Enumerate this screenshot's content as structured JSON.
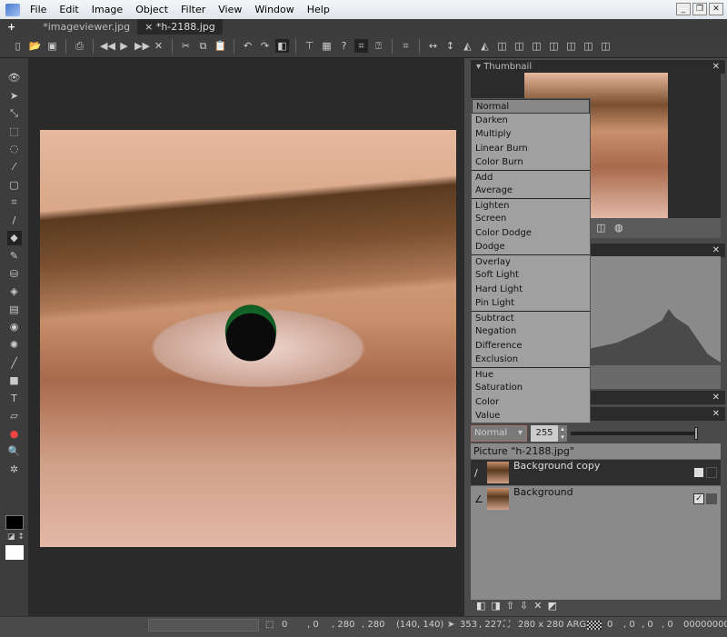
{
  "menu": {
    "items": [
      "File",
      "Edit",
      "Image",
      "Object",
      "Filter",
      "View",
      "Window",
      "Help"
    ]
  },
  "tabs": [
    {
      "label": "*imageviewer.jpg",
      "active": false
    },
    {
      "label": "*h-2188.jpg",
      "active": true,
      "close": "×"
    }
  ],
  "toolbar_icons": [
    "new-icon",
    "open-icon",
    "save-icon",
    "print-icon",
    "first-icon",
    "play-icon",
    "last-icon",
    "close-icon",
    "cut-icon",
    "copy-icon",
    "paste-icon",
    "undo-icon",
    "redo-icon",
    "split-view-icon",
    "crop-icon",
    "grid-icon",
    "help-icon",
    "crop-active-icon",
    "zoom-help-icon",
    "resize-icon",
    "flip-h-icon",
    "flip-v-icon",
    "rotate-icon"
  ],
  "panels": {
    "thumbnail": {
      "title": "Thumbnail"
    }
  },
  "blend_modes": {
    "selected": "Normal",
    "groups": [
      [
        "Normal",
        "Darken",
        "Multiply",
        "Linear Burn",
        "Color Burn"
      ],
      [
        "Add",
        "Average"
      ],
      [
        "Lighten",
        "Screen",
        "Color Dodge",
        "Dodge"
      ],
      [
        "Overlay",
        "Soft Light",
        "Hard Light",
        "Pin Light"
      ],
      [
        "Subtract",
        "Negation",
        "Difference",
        "Exclusion"
      ],
      [
        "Hue",
        "Saturation",
        "Color",
        "Value"
      ]
    ]
  },
  "layers": {
    "blend": "Normal",
    "opacity": "255",
    "picture": "Picture \"h-2188.jpg\"",
    "items": [
      {
        "name": "Background copy",
        "visible": true,
        "selected": true
      },
      {
        "name": "Background",
        "visible": true,
        "locked": true
      }
    ]
  },
  "status": {
    "sel_x": "0",
    "sel_y": ", 0",
    "sel_w": ", 280",
    "sel_h": ", 280",
    "center": "(140, 140)",
    "cursor_x": "353",
    "cursor_y": ", 227",
    "size": "280 x 280 ARGB",
    "c1": "0",
    "c2": ", 0",
    "c3": ", 0",
    "c4": ", 0",
    "hex": "00000000"
  },
  "colors": {
    "foreground": "#000000",
    "background": "#ffffff"
  }
}
